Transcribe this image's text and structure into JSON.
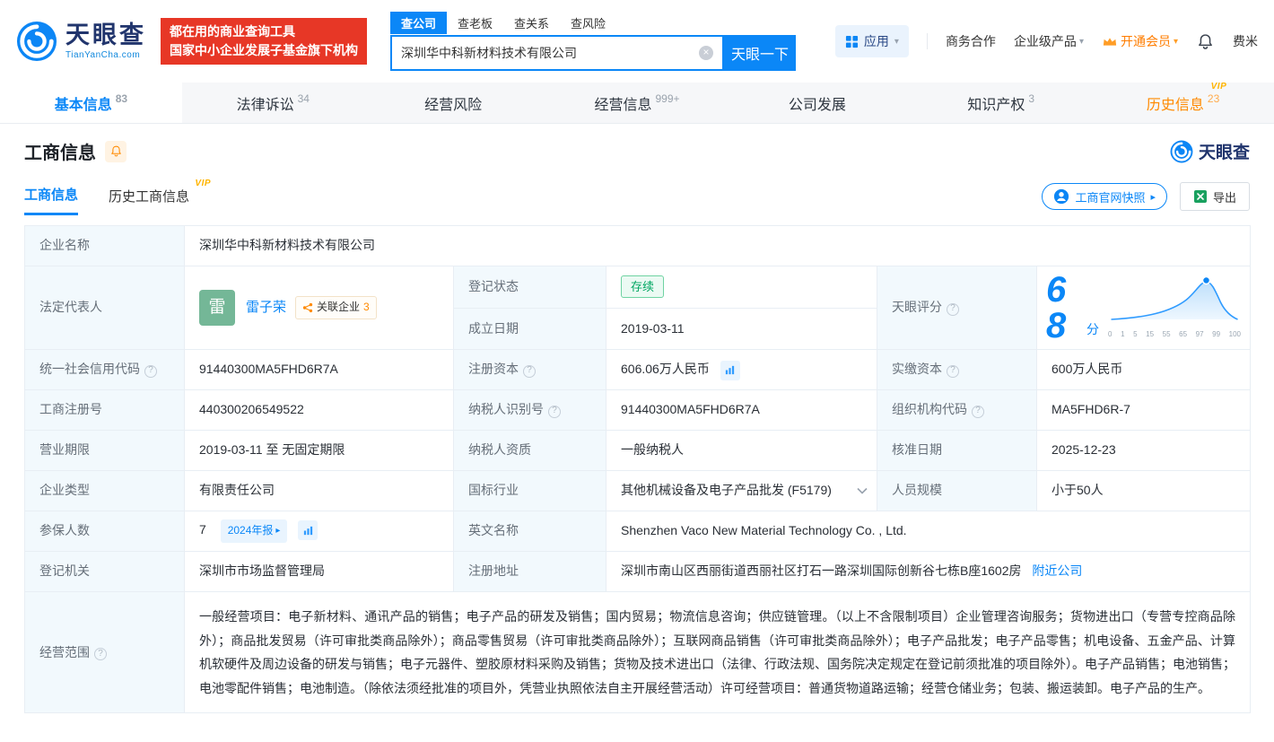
{
  "brand": {
    "name": "天眼查",
    "domain": "TianYanCha.com"
  },
  "promo": {
    "line1": "都在用的商业查询工具",
    "line2": "国家中小企业发展子基金旗下机构"
  },
  "search": {
    "tabs": [
      {
        "label": "查公司"
      },
      {
        "label": "查老板"
      },
      {
        "label": "查关系"
      },
      {
        "label": "查风险"
      }
    ],
    "value": "深圳华中科新材料技术有限公司",
    "button": "天眼一下"
  },
  "topnav": {
    "app": "应用",
    "cooperation": "商务合作",
    "enterprise": "企业级产品",
    "vip": "开通会员",
    "username": "费米"
  },
  "tabs": [
    {
      "label": "基本信息",
      "count": "83"
    },
    {
      "label": "法律诉讼",
      "count": "34"
    },
    {
      "label": "经营风险",
      "count": ""
    },
    {
      "label": "经营信息",
      "count": "999+"
    },
    {
      "label": "公司发展",
      "count": ""
    },
    {
      "label": "知识产权",
      "count": "3"
    },
    {
      "label": "历史信息",
      "count": "23",
      "vip": "VIP"
    }
  ],
  "section": {
    "title": "工商信息",
    "brand": "天眼查",
    "subtab_active": "工商信息",
    "subtab_history": "历史工商信息",
    "vip": "VIP",
    "snapshot_button": "工商官网快照",
    "export_button": "导出"
  },
  "fields": {
    "company_name": {
      "label": "企业名称",
      "value": "深圳华中科新材料技术有限公司"
    },
    "legal_rep": {
      "label": "法定代表人",
      "avatar": "雷",
      "name": "雷子荣",
      "related_label": "关联企业",
      "related_count": "3"
    },
    "reg_status": {
      "label": "登记状态",
      "value": "存续"
    },
    "establish_date": {
      "label": "成立日期",
      "value": "2019-03-11"
    },
    "score": {
      "label": "天眼评分",
      "value": "68",
      "unit": "分",
      "axis": [
        "0",
        "1",
        "5",
        "15",
        "55",
        "65",
        "97",
        "99",
        "100"
      ]
    },
    "credit_code": {
      "label": "统一社会信用代码",
      "value": "91440300MA5FHD6R7A"
    },
    "reg_capital": {
      "label": "注册资本",
      "value": "606.06万人民币"
    },
    "paid_capital": {
      "label": "实缴资本",
      "value": "600万人民币"
    },
    "reg_number": {
      "label": "工商注册号",
      "value": "440300206549522"
    },
    "taxpayer_id": {
      "label": "纳税人识别号",
      "value": "91440300MA5FHD6R7A"
    },
    "org_code": {
      "label": "组织机构代码",
      "value": "MA5FHD6R-7"
    },
    "term": {
      "label": "营业期限",
      "value": "2019-03-11 至 无固定期限"
    },
    "taxpayer_quality": {
      "label": "纳税人资质",
      "value": "一般纳税人"
    },
    "approval_date": {
      "label": "核准日期",
      "value": "2025-12-23"
    },
    "company_type": {
      "label": "企业类型",
      "value": "有限责任公司"
    },
    "industry": {
      "label": "国标行业",
      "value": "其他机械设备及电子产品批发 (F5179)"
    },
    "staff_size": {
      "label": "人员规模",
      "value": "小于50人"
    },
    "insured": {
      "label": "参保人数",
      "value": "7",
      "report": "2024年报"
    },
    "english_name": {
      "label": "英文名称",
      "value": "Shenzhen Vaco New Material Technology Co. , Ltd."
    },
    "authority": {
      "label": "登记机关",
      "value": "深圳市市场监督管理局"
    },
    "address": {
      "label": "注册地址",
      "value": "深圳市南山区西丽街道西丽社区打石一路深圳国际创新谷七栋B座1602房",
      "link": "附近公司"
    },
    "scope": {
      "label": "经营范围",
      "value": "一般经营项目：电子新材料、通讯产品的销售；电子产品的研发及销售；国内贸易；物流信息咨询；供应链管理。（以上不含限制项目）企业管理咨询服务；货物进出口（专营专控商品除外）；商品批发贸易（许可审批类商品除外）；商品零售贸易（许可审批类商品除外）；互联网商品销售（许可审批类商品除外）；电子产品批发；电子产品零售；机电设备、五金产品、计算机软硬件及周边设备的研发与销售；电子元器件、塑胶原材料采购及销售；货物及技术进出口（法律、行政法规、国务院决定规定在登记前须批准的项目除外）。电子产品销售；电池销售；电池零配件销售；电池制造。（除依法须经批准的项目外，凭营业执照依法自主开展经营活动）许可经营项目：普通货物道路运输；经营仓储业务；包装、搬运装卸。电子产品的生产。"
    }
  }
}
